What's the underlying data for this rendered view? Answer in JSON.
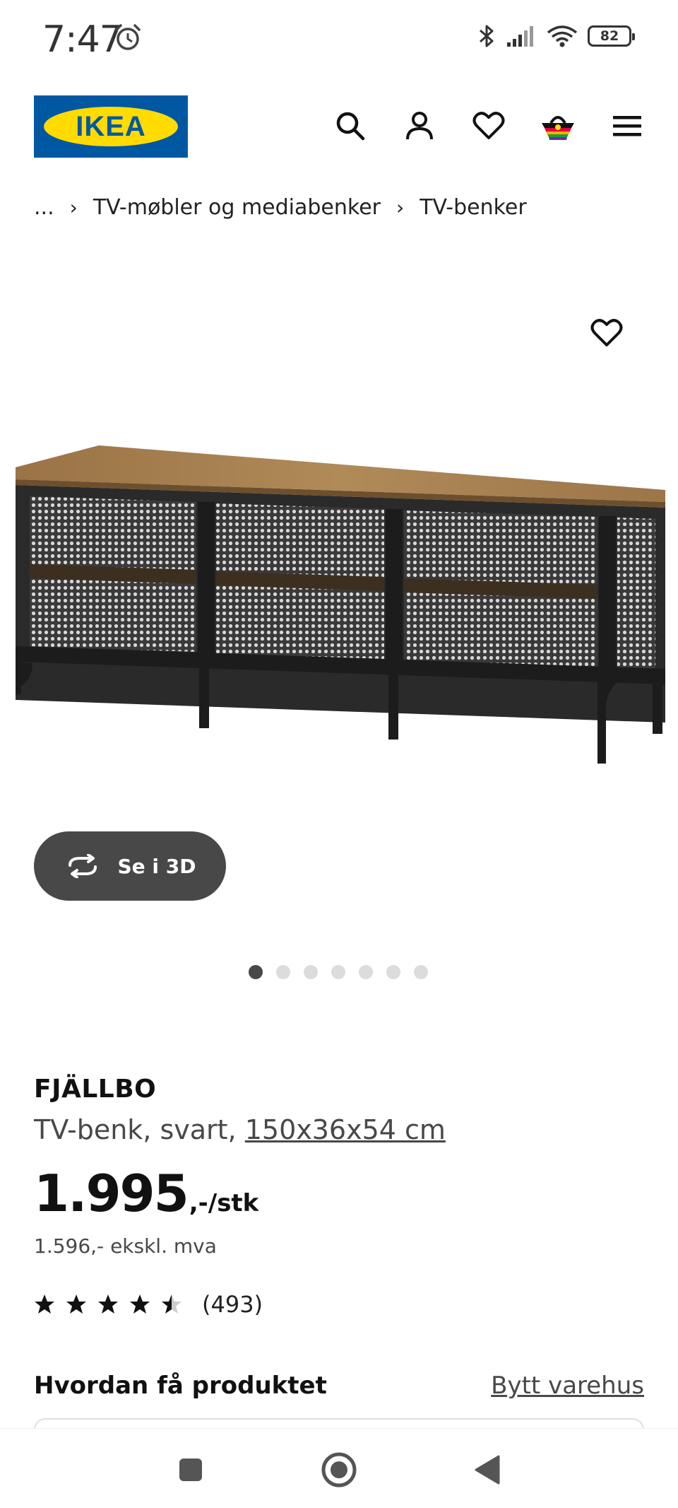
{
  "status_bar": {
    "time": "7:47",
    "battery": "82"
  },
  "header": {
    "logo_text": "IKEA",
    "icons": [
      "search-icon",
      "account-icon",
      "heart-icon",
      "basket-icon",
      "menu-icon"
    ]
  },
  "breadcrumb": {
    "items": [
      "...",
      "TV-møbler og mediabenker",
      "TV-benker"
    ]
  },
  "gallery": {
    "view_3d_label": "Se i 3D",
    "image_count": 7,
    "active_index": 0
  },
  "product": {
    "name": "FJÄLLBO",
    "description": "TV-benk, svart,",
    "measurements": "150x36x54 cm",
    "price": "1.995",
    "price_suffix": ",-/stk",
    "price_ex_vat": "1.596,- ekskl. mva",
    "rating": 4.5,
    "rating_max": 5,
    "review_count": "(493)"
  },
  "delivery": {
    "title": "Hvordan få produktet",
    "change_store_label": "Bytt varehus"
  },
  "colors": {
    "ikea_blue": "#0058a3",
    "ikea_yellow": "#ffdb00",
    "button_dark": "#484848"
  }
}
